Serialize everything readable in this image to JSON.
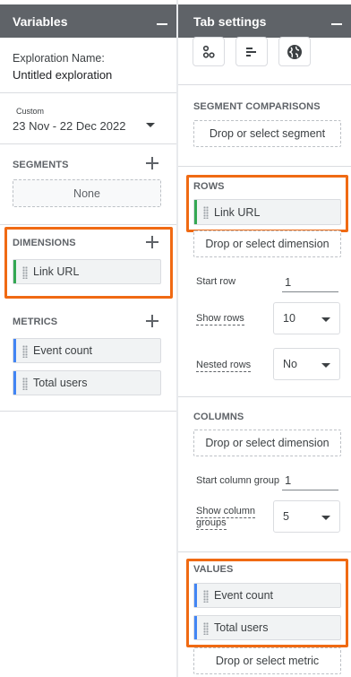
{
  "left": {
    "header": "Variables",
    "exploration_label": "Exploration Name:",
    "exploration_value": "Untitled exploration",
    "date_tag": "Custom",
    "date_range": "23 Nov - 22 Dec 2022",
    "segments_label": "SEGMENTS",
    "segments_none": "None",
    "dimensions_label": "DIMENSIONS",
    "dimensions": [
      "Link URL"
    ],
    "metrics_label": "METRICS",
    "metrics": [
      "Event count",
      "Total users"
    ]
  },
  "right": {
    "header": "Tab settings",
    "tech_icons": [
      "scatter-icon",
      "bar-chart-icon",
      "globe-icon"
    ],
    "segment_comparisons_label": "SEGMENT COMPARISONS",
    "segment_drop": "Drop or select segment",
    "rows_label": "ROWS",
    "rows_chip": "Link URL",
    "rows_drop": "Drop or select dimension",
    "start_row_label": "Start row",
    "start_row_value": "1",
    "show_rows_label": "Show rows",
    "show_rows_value": "10",
    "nested_rows_label": "Nested rows",
    "nested_rows_value": "No",
    "columns_label": "COLUMNS",
    "columns_drop": "Drop or select dimension",
    "start_column_group_label": "Start column group",
    "start_column_group_value": "1",
    "show_column_groups_label_1": "Show column",
    "show_column_groups_label_2": "groups",
    "show_column_groups_value": "5",
    "values_label": "VALUES",
    "values": [
      "Event count",
      "Total users"
    ],
    "values_drop": "Drop or select metric"
  },
  "colors": {
    "highlight": "#f06a13",
    "header_bg": "#5f6368",
    "dimension_bar": "#34a853",
    "metric_bar": "#4285f4"
  }
}
